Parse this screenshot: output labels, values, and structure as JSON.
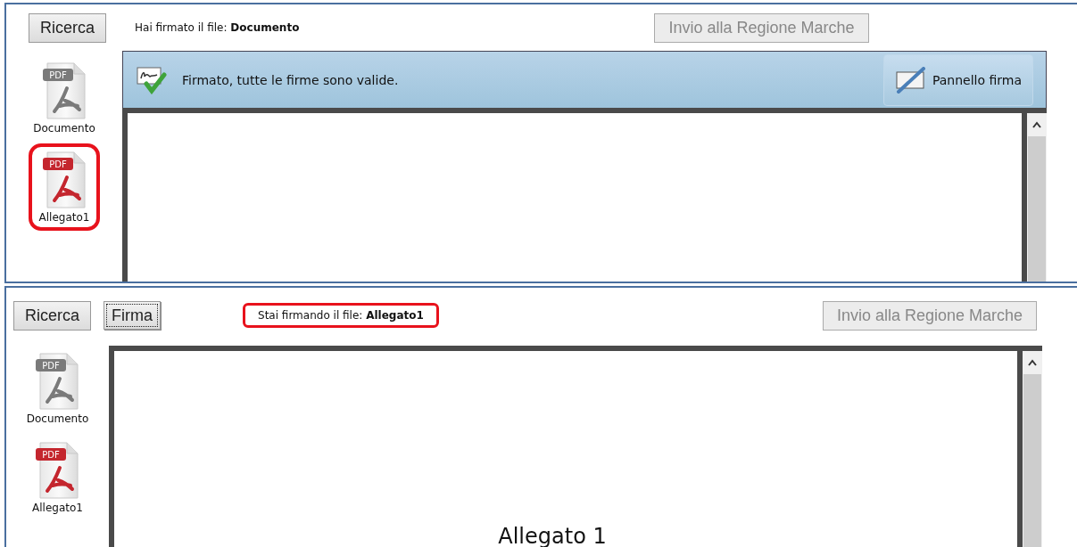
{
  "panels": [
    {
      "buttons": [
        {
          "label": "Ricerca",
          "focused": false
        }
      ],
      "status": {
        "text": "Hai firmato il file: **Documento**",
        "highlighted": false
      },
      "send_button": {
        "label": "Invio alla Regione Marche",
        "disabled": true
      },
      "files": [
        {
          "name": "Documento",
          "badge": "PDF",
          "color": "#7a7a7a",
          "highlighted": false
        },
        {
          "name": "Allegato1",
          "badge": "PDF",
          "color": "#c4262e",
          "highlighted": true
        }
      ],
      "signature_bar": {
        "message": "Firmato, tutte le firme sono valide.",
        "button": "Pannello firma"
      }
    },
    {
      "buttons": [
        {
          "label": "Ricerca",
          "focused": false
        },
        {
          "label": "Firma",
          "focused": true
        }
      ],
      "status": {
        "text": "Stai firmando il file: **Allegato1**",
        "highlighted": true
      },
      "send_button": {
        "label": "Invio alla Regione Marche",
        "disabled": true
      },
      "files": [
        {
          "name": "Documento",
          "badge": "PDF",
          "color": "#7a7a7a",
          "highlighted": false
        },
        {
          "name": "Allegato1",
          "badge": "PDF",
          "color": "#c4262e",
          "highlighted": false
        }
      ],
      "viewer": {
        "document_title": "Allegato 1"
      }
    }
  ]
}
